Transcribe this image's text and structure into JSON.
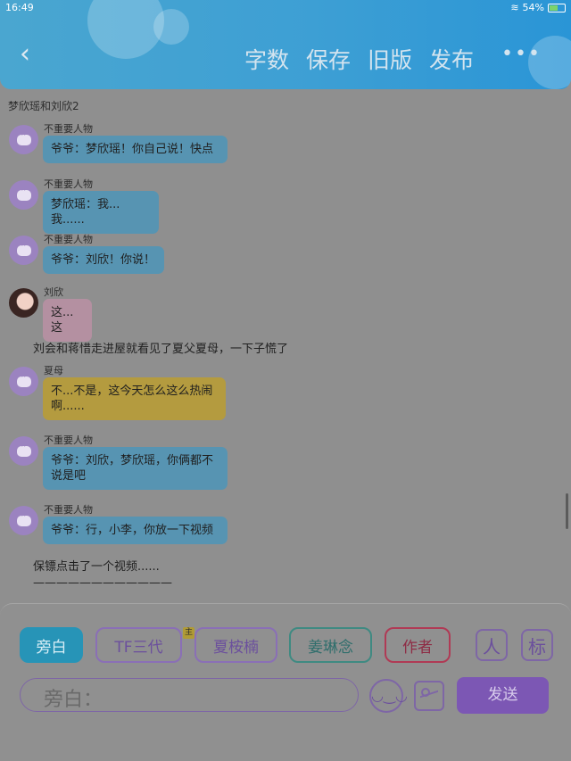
{
  "status_bar": {
    "time": "16:49",
    "battery": "54%"
  },
  "header": {
    "buttons": [
      "字数",
      "保存",
      "旧版",
      "发布"
    ],
    "more": "•••"
  },
  "chat": {
    "title": "梦欣瑶和刘欣2",
    "messages": [
      {
        "speaker": "不重要人物",
        "text": "爷爷：梦欣瑶！你自己说！快点"
      },
      {
        "speaker": "不重要人物",
        "text": "梦欣瑶：我...我......"
      },
      {
        "speaker": "不重要人物",
        "text": "爷爷：刘欣！你说！"
      },
      {
        "speaker": "刘欣",
        "text": "这...这"
      },
      {
        "narration": "刘会和蒋惜走进屋就看见了夏父夏母，一下子慌了"
      },
      {
        "speaker": "夏母",
        "text_line1": "不...不是，这今天怎么这么热闹",
        "text_line2": "啊......"
      },
      {
        "speaker": "不重要人物",
        "text_line1": "爷爷：刘欣，梦欣瑶，你俩都不",
        "text_line2": "说是吧"
      },
      {
        "speaker": "不重要人物",
        "text": "爷爷：行，小李，你放一下视频"
      },
      {
        "narration": "保镖点击了一个视频......"
      },
      {
        "narration": "————————————"
      }
    ]
  },
  "roles": [
    "旁白",
    "TF三代",
    "夏桉楠",
    "姜琳念",
    "作者"
  ],
  "role_badge": "主",
  "icons": {
    "contacts": "人",
    "tag": "标"
  },
  "input": {
    "placeholder": "旁白："
  },
  "send_label": "发送"
}
